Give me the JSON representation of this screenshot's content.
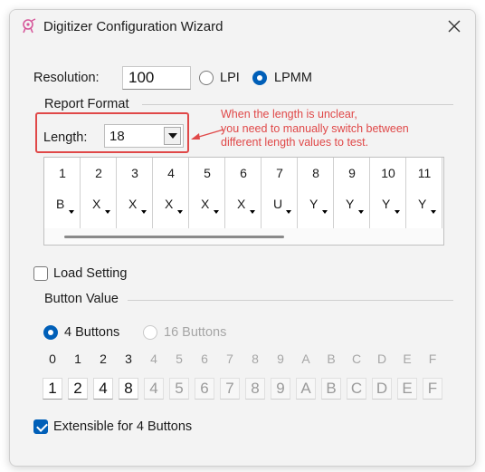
{
  "window": {
    "title": "Digitizer Configuration Wizard"
  },
  "resolution": {
    "label": "Resolution:",
    "value": "100",
    "options": [
      {
        "label": "LPI",
        "selected": false
      },
      {
        "label": "LPMM",
        "selected": true
      }
    ]
  },
  "report_format": {
    "group_label": "Report Format",
    "length_label": "Length:",
    "length_value": "18",
    "annotation": [
      "When the length is unclear,",
      "you need to manually switch between",
      "different length values to test."
    ],
    "columns": [
      {
        "num": "1",
        "value": "B"
      },
      {
        "num": "2",
        "value": "X"
      },
      {
        "num": "3",
        "value": "X"
      },
      {
        "num": "4",
        "value": "X"
      },
      {
        "num": "5",
        "value": "X"
      },
      {
        "num": "6",
        "value": "X"
      },
      {
        "num": "7",
        "value": "U"
      },
      {
        "num": "8",
        "value": "Y"
      },
      {
        "num": "9",
        "value": "Y"
      },
      {
        "num": "10",
        "value": "Y"
      },
      {
        "num": "11",
        "value": "Y"
      }
    ]
  },
  "load_setting": {
    "label": "Load Setting",
    "checked": false
  },
  "button_value": {
    "group_label": "Button Value",
    "options": [
      {
        "label": "4 Buttons",
        "selected": true,
        "enabled": true
      },
      {
        "label": "16 Buttons",
        "selected": false,
        "enabled": false
      }
    ],
    "bit_labels": [
      "0",
      "1",
      "2",
      "3",
      "4",
      "5",
      "6",
      "7",
      "8",
      "9",
      "A",
      "B",
      "C",
      "D",
      "E",
      "F"
    ],
    "bit_values": [
      "1",
      "2",
      "4",
      "8",
      "4",
      "5",
      "6",
      "7",
      "8",
      "9",
      "A",
      "B",
      "C",
      "D",
      "E",
      "F"
    ],
    "active_count": 4
  },
  "extensible": {
    "label": "Extensible for 4 Buttons",
    "checked": true
  },
  "colors": {
    "accent": "#005fb8",
    "annotation": "#e04848"
  }
}
